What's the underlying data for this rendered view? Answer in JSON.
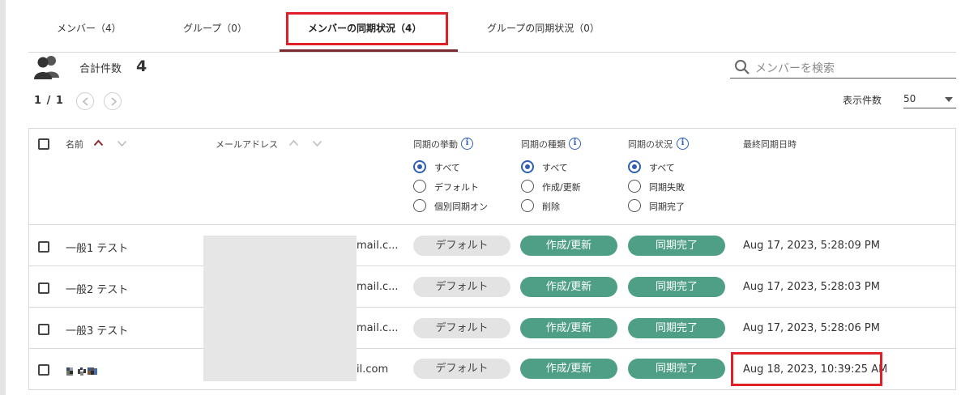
{
  "tabs": [
    {
      "label": "メンバー（4）"
    },
    {
      "label": "グループ（0）"
    },
    {
      "label": "メンバーの同期状況（4）"
    },
    {
      "label": "グループの同期状況（0）"
    }
  ],
  "summary": {
    "total_label": "合計件数",
    "total_value": "4"
  },
  "pagination": {
    "page_info": "1 / 1"
  },
  "search": {
    "placeholder": "メンバーを検索"
  },
  "per_page": {
    "label": "表示件数",
    "value": "50"
  },
  "table": {
    "headers": {
      "name": "名前",
      "email": "メールアドレス",
      "sync_behavior": "同期の挙動",
      "sync_type": "同期の種類",
      "sync_status": "同期の状況",
      "last_sync": "最終同期日時"
    },
    "filters": {
      "sync_behavior": [
        "すべて",
        "デフォルト",
        "個別同期オン"
      ],
      "sync_type": [
        "すべて",
        "作成/更新",
        "削除"
      ],
      "sync_status": [
        "すべて",
        "同期失敗",
        "同期完了"
      ]
    },
    "rows": [
      {
        "name": "一般1 テスト",
        "email_suffix": "mail.c...",
        "behavior": "デフォルト",
        "type": "作成/更新",
        "status": "同期完了",
        "last_sync": "Aug 17, 2023, 5:28:09 PM"
      },
      {
        "name": "一般2 テスト",
        "email_suffix": "mail.c...",
        "behavior": "デフォルト",
        "type": "作成/更新",
        "status": "同期完了",
        "last_sync": "Aug 17, 2023, 5:28:03 PM"
      },
      {
        "name": "一般3 テスト",
        "email_suffix": "mail.c...",
        "behavior": "デフォルト",
        "type": "作成/更新",
        "status": "同期完了",
        "last_sync": "Aug 17, 2023, 5:28:06 PM"
      },
      {
        "name": "",
        "email_suffix": "il.com",
        "behavior": "デフォルト",
        "type": "作成/更新",
        "status": "同期完了",
        "last_sync": "Aug 18, 2023, 10:39:25 AM"
      }
    ]
  },
  "colors": {
    "accent_green": "#4f9f86",
    "radio_blue": "#2f5fb3",
    "highlight_red": "#e01f26",
    "tab_underline": "#7b2a2e"
  },
  "icons": [
    "people-icon",
    "search-icon",
    "info-icon",
    "chevron-left-icon",
    "chevron-right-icon",
    "sort-up-icon",
    "sort-down-icon",
    "caret-down-icon"
  ]
}
